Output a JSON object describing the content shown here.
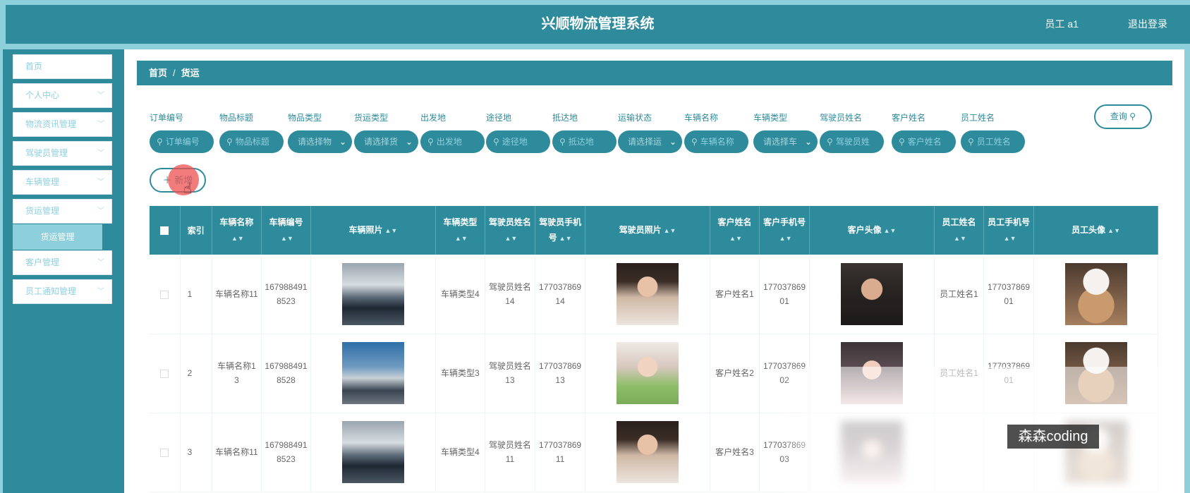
{
  "header": {
    "title": "兴顺物流管理系统",
    "user": "员工 a1",
    "logout": "退出登录"
  },
  "sidebar": {
    "items": [
      {
        "label": "首页",
        "chevron": false
      },
      {
        "label": "个人中心",
        "chevron": true
      },
      {
        "label": "物流资讯管理",
        "chevron": true
      },
      {
        "label": "驾驶员管理",
        "chevron": true
      },
      {
        "label": "车辆管理",
        "chevron": true
      },
      {
        "label": "货运管理",
        "chevron": true
      },
      {
        "label": "客户管理",
        "chevron": true
      },
      {
        "label": "员工通知管理",
        "chevron": true
      }
    ],
    "sub_item": "货运管理"
  },
  "breadcrumb": {
    "home": "首页",
    "sep": "/",
    "current": "货运"
  },
  "filters": [
    {
      "label": "订单编号",
      "placeholder": "订单编号",
      "type": "input"
    },
    {
      "label": "物品标题",
      "placeholder": "物品标题",
      "type": "input"
    },
    {
      "label": "物品类型",
      "placeholder": "请选择物",
      "type": "select"
    },
    {
      "label": "货运类型",
      "placeholder": "请选择货",
      "type": "select"
    },
    {
      "label": "出发地",
      "placeholder": "出发地",
      "type": "input"
    },
    {
      "label": "途径地",
      "placeholder": "途径地",
      "type": "input"
    },
    {
      "label": "抵达地",
      "placeholder": "抵达地",
      "type": "input"
    },
    {
      "label": "运输状态",
      "placeholder": "请选择运",
      "type": "select"
    },
    {
      "label": "车辆名称",
      "placeholder": "车辆名称",
      "type": "input"
    },
    {
      "label": "车辆类型",
      "placeholder": "请选择车",
      "type": "select"
    },
    {
      "label": "驾驶员姓名",
      "placeholder": "驾驶员姓",
      "type": "input"
    },
    {
      "label": "客户姓名",
      "placeholder": "客户姓名",
      "type": "input"
    },
    {
      "label": "员工姓名",
      "placeholder": "员工姓名",
      "type": "input"
    }
  ],
  "buttons": {
    "query": "查询",
    "add": "新增"
  },
  "table": {
    "columns": [
      "索引",
      "车辆名称",
      "车辆编号",
      "车辆照片",
      "车辆类型",
      "驾驶员姓名",
      "驾驶员手机号",
      "驾驶员照片",
      "客户姓名",
      "客户手机号",
      "客户头像",
      "员工姓名",
      "员工手机号",
      "员工头像"
    ],
    "rows": [
      {
        "index": "1",
        "vehicle_name": "车辆名称11",
        "vehicle_no": "1679884918523",
        "vehicle_photo": "car-dark-suv",
        "vehicle_type": "车辆类型4",
        "driver_name": "驾驶员姓名14",
        "driver_phone": "17703786914",
        "driver_photo": "young-man",
        "customer_name": "客户姓名1",
        "customer_phone": "17703786901",
        "customer_avatar": "man-dark-jacket",
        "employee_name": "员工姓名1",
        "employee_phone": "17703786901",
        "employee_avatar": "cat-white-hat"
      },
      {
        "index": "2",
        "vehicle_name": "车辆名称13",
        "vehicle_no": "1679884918528",
        "vehicle_photo": "car-gullwing",
        "vehicle_type": "车辆类型3",
        "driver_name": "驾驶员姓名13",
        "driver_phone": "17703786913",
        "driver_photo": "girl-green-sweater",
        "customer_name": "客户姓名2",
        "customer_phone": "17703786902",
        "customer_avatar": "woman-dark-hair",
        "employee_name": "员工姓名1",
        "employee_phone": "17703786901",
        "employee_avatar": "cat-white-hat"
      },
      {
        "index": "3",
        "vehicle_name": "车辆名称11",
        "vehicle_no": "1679884918523",
        "vehicle_photo": "car-dark-suv",
        "vehicle_type": "车辆类型4",
        "driver_name": "驾驶员姓名11",
        "driver_phone": "17703786911",
        "driver_photo": "young-man",
        "customer_name": "客户姓名3",
        "customer_phone": "17703786903",
        "customer_avatar": "woman-blurred",
        "employee_name": "",
        "employee_phone": "",
        "employee_avatar": "cat-blurred"
      }
    ]
  },
  "watermark": "森森coding",
  "colors": {
    "primary": "#2e8b9b",
    "light": "#8ecfdc"
  }
}
